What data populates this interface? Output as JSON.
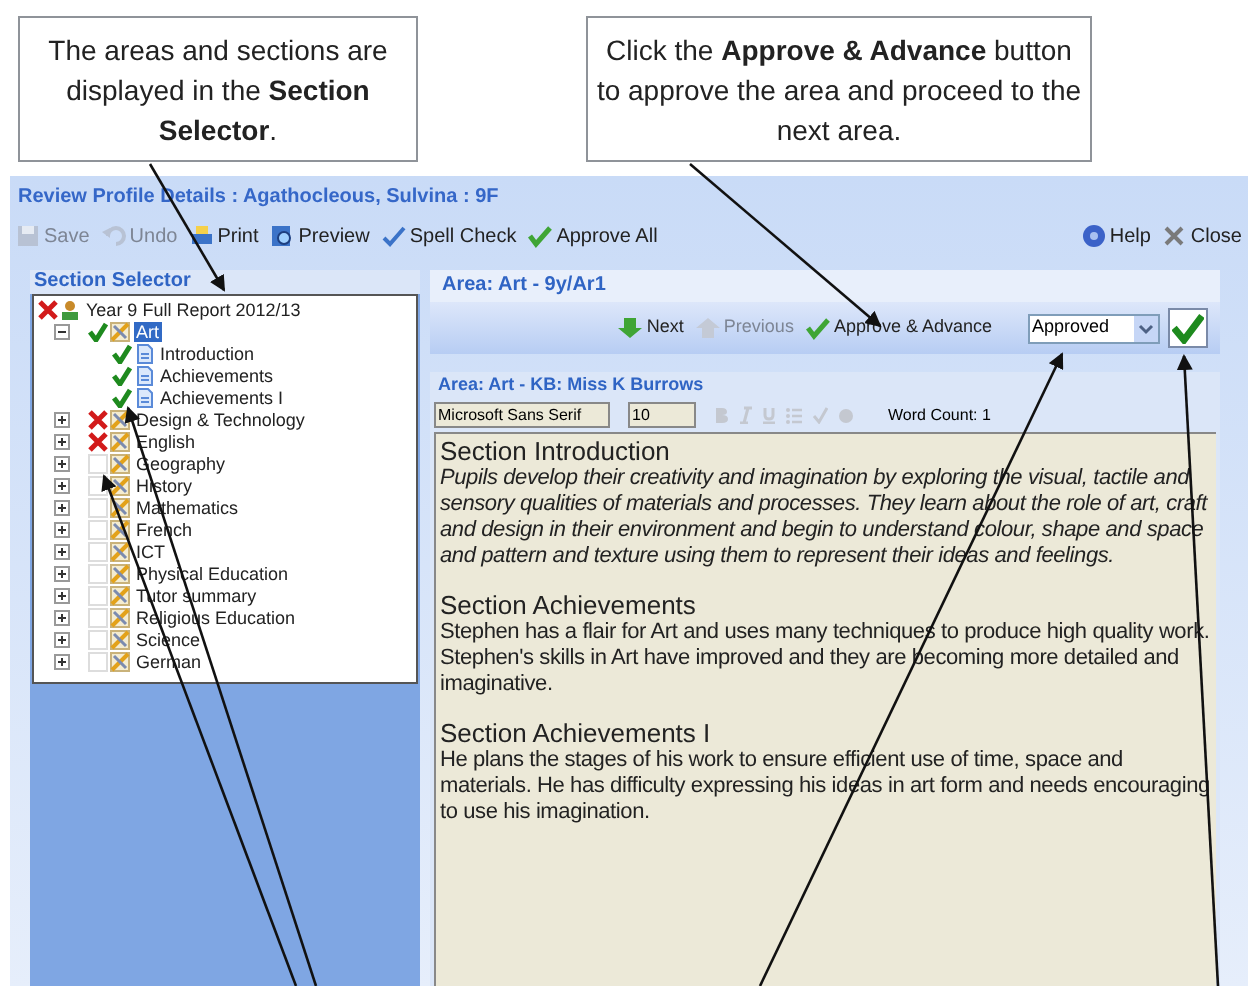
{
  "callouts": [
    "The areas and sections are displayed in the **Section Selector**.",
    "Click the **Approve & Advance** button to approve the area and proceed to the next area."
  ],
  "window": {
    "title": "Review Profile Details : Agathocleous, Sulvina : 9F"
  },
  "toolbar": [
    {
      "label": "Save",
      "kind": "save",
      "disabled": true
    },
    {
      "label": "Undo",
      "kind": "undo",
      "disabled": true
    },
    {
      "label": "Print",
      "kind": "print",
      "disabled": false
    },
    {
      "label": "Preview",
      "kind": "preview",
      "disabled": false
    },
    {
      "label": "Spell Check",
      "kind": "spell",
      "disabled": false
    },
    {
      "label": "Approve All",
      "kind": "approve",
      "disabled": false
    }
  ],
  "toolbar_right": [
    {
      "label": "Help",
      "kind": "help"
    },
    {
      "label": "Close",
      "kind": "close"
    }
  ],
  "section_selector": {
    "title": "Section Selector",
    "tree": [
      {
        "label": "Year 9 Full Report 2012/13",
        "approved": false,
        "rejected": true,
        "kind": "report",
        "selected": false,
        "children": [
          {
            "label": "Art",
            "approved": true,
            "rejected": false,
            "kind": "area",
            "expanded": true,
            "selected": true,
            "children": [
              {
                "label": "Introduction",
                "approved": true,
                "rejected": false,
                "kind": "section",
                "selected": false
              },
              {
                "label": "Achievements",
                "approved": true,
                "rejected": false,
                "kind": "section",
                "selected": false
              },
              {
                "label": "Achievements I",
                "approved": true,
                "rejected": false,
                "kind": "section",
                "selected": false
              }
            ]
          },
          {
            "label": "Design & Technology",
            "approved": false,
            "rejected": true,
            "kind": "area",
            "expanded": false,
            "selected": false
          },
          {
            "label": "English",
            "approved": false,
            "rejected": true,
            "kind": "area",
            "expanded": false,
            "selected": false
          },
          {
            "label": "Geography",
            "approved": false,
            "rejected": false,
            "kind": "area",
            "expanded": false,
            "selected": false
          },
          {
            "label": "History",
            "approved": false,
            "rejected": false,
            "kind": "area",
            "expanded": false,
            "selected": false
          },
          {
            "label": "Mathematics",
            "approved": false,
            "rejected": false,
            "kind": "area",
            "expanded": false,
            "selected": false
          },
          {
            "label": "French",
            "approved": false,
            "rejected": false,
            "kind": "area",
            "expanded": false,
            "selected": false
          },
          {
            "label": "ICT",
            "approved": false,
            "rejected": false,
            "kind": "area",
            "expanded": false,
            "selected": false
          },
          {
            "label": "Physical Education",
            "approved": false,
            "rejected": false,
            "kind": "area",
            "expanded": false,
            "selected": false
          },
          {
            "label": "Tutor summary",
            "approved": false,
            "rejected": false,
            "kind": "area",
            "expanded": false,
            "selected": false
          },
          {
            "label": "Religious Education",
            "approved": false,
            "rejected": false,
            "kind": "area",
            "expanded": false,
            "selected": false
          },
          {
            "label": "Science",
            "approved": false,
            "rejected": false,
            "kind": "area",
            "expanded": false,
            "selected": false
          },
          {
            "label": "German",
            "approved": false,
            "rejected": false,
            "kind": "area",
            "expanded": false,
            "selected": false
          }
        ]
      }
    ]
  },
  "area": {
    "title": "Area: Art - 9y/Ar1",
    "nav": [
      {
        "label": "Next",
        "kind": "next",
        "disabled": false
      },
      {
        "label": "Previous",
        "kind": "previous",
        "disabled": true
      },
      {
        "label": "Approve & Advance",
        "kind": "approve",
        "disabled": false
      }
    ],
    "status": {
      "value": "Approved"
    },
    "approved": true
  },
  "editor": {
    "title": "Area: Art - KB: Miss K Burrows",
    "font": {
      "value": "Microsoft Sans Serif"
    },
    "size": {
      "value": "10"
    },
    "word_count": "Word Count: 1",
    "sections": [
      {
        "heading": "Section Introduction",
        "text": "Pupils develop their creativity and imagination by exploring the visual, tactile and sensory qualities of materials and processes. They learn about the role of art, craft and design in their environment and begin to understand colour, shape and space and pattern and texture using them to represent their ideas and feelings.",
        "italic": true
      },
      {
        "heading": "Section Achievements",
        "text": "Stephen has a flair for Art and uses many techniques to produce high quality work. Stephen's skills in Art have improved and they are becoming more detailed and imaginative.",
        "italic": false
      },
      {
        "heading": "Section Achievements I",
        "text": "He plans the stages of his work to ensure efficient use of time, space and materials. He has difficulty expressing his ideas in art form and needs encouraging to use his imagination.",
        "italic": false
      }
    ]
  }
}
